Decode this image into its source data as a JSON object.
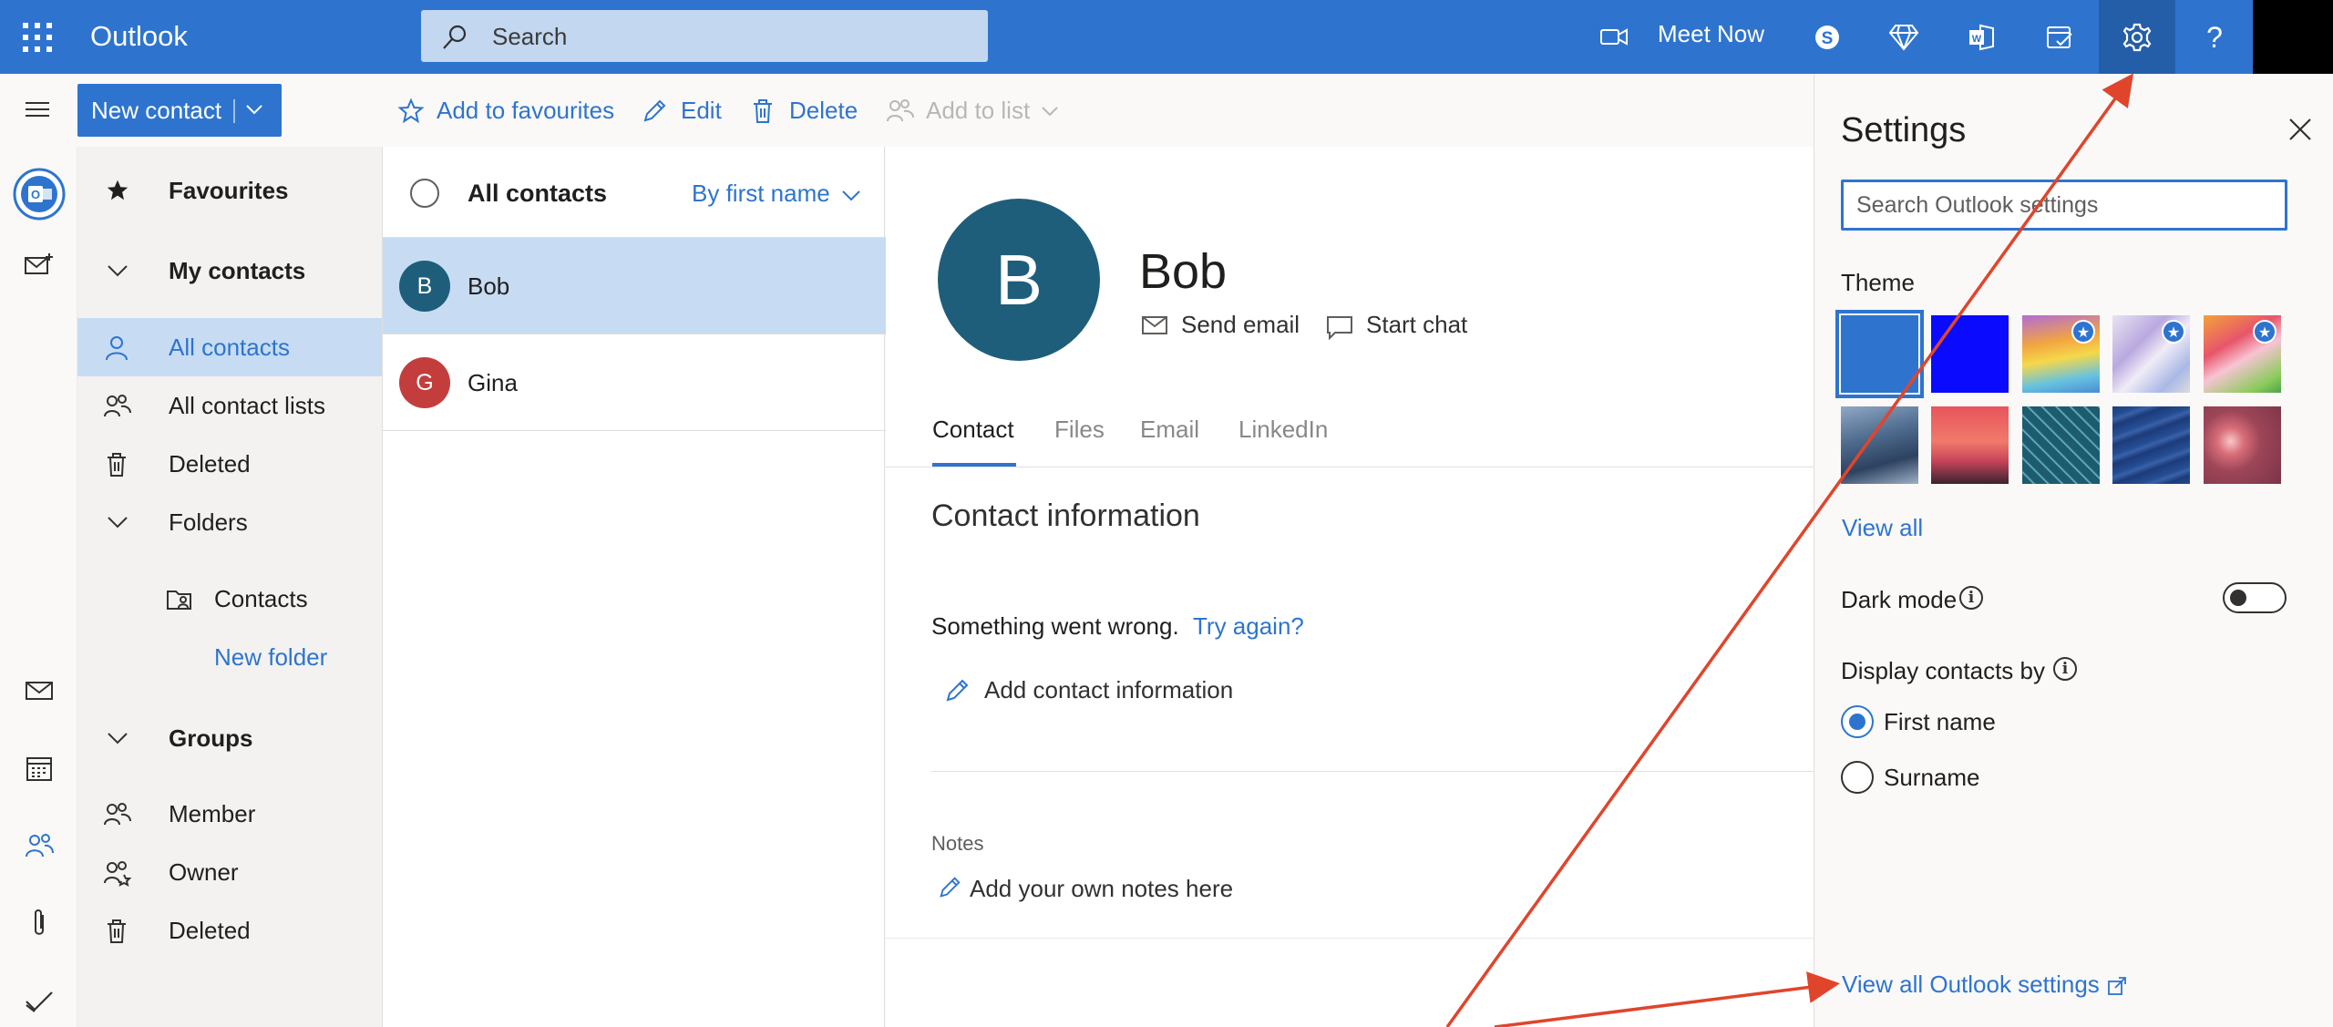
{
  "topbar": {
    "app_name": "Outlook",
    "search_placeholder": "Search",
    "meet_now_label": "Meet Now",
    "icons": [
      "skype-icon",
      "diamond-icon",
      "office-icon",
      "my-day-icon",
      "gear-icon",
      "help-icon"
    ]
  },
  "toolbar": {
    "new_contact_label": "New contact",
    "add_to_favourites_label": "Add to favourites",
    "edit_label": "Edit",
    "delete_label": "Delete",
    "add_to_list_label": "Add to list"
  },
  "folders": {
    "favourites": "Favourites",
    "my_contacts": "My contacts",
    "all_contacts": "All contacts",
    "all_contact_lists": "All contact lists",
    "deleted": "Deleted",
    "folders": "Folders",
    "contacts": "Contacts",
    "new_folder": "New folder",
    "groups": "Groups",
    "member": "Member",
    "owner": "Owner",
    "groups_deleted": "Deleted"
  },
  "list": {
    "title": "All contacts",
    "sort_label": "By first name",
    "contacts": [
      {
        "initial": "B",
        "name": "Bob",
        "color": "#1e5e7a",
        "selected": true
      },
      {
        "initial": "G",
        "name": "Gina",
        "color": "#c43d3d",
        "selected": false
      }
    ]
  },
  "contact": {
    "initial": "B",
    "name": "Bob",
    "send_email_label": "Send email",
    "start_chat_label": "Start chat",
    "tabs": [
      "Contact",
      "Files",
      "Email",
      "LinkedIn"
    ],
    "active_tab": "Contact",
    "section_title": "Contact information",
    "error_message": "Something went wrong.",
    "try_again_label": "Try again?",
    "add_info_label": "Add contact information",
    "notes_label": "Notes",
    "notes_placeholder": "Add your own notes here"
  },
  "settings": {
    "title": "Settings",
    "search_placeholder": "Search Outlook settings",
    "theme_label": "Theme",
    "view_all_label": "View all",
    "dark_mode_label": "Dark mode",
    "dark_mode_on": false,
    "display_contacts_label": "Display contacts by",
    "options": [
      "First name",
      "Surname"
    ],
    "selected_option": "First name",
    "view_all_settings_label": "View all Outlook settings"
  },
  "colors": {
    "accent": "#2e74cf",
    "annotation_arrow": "#e0452c"
  }
}
